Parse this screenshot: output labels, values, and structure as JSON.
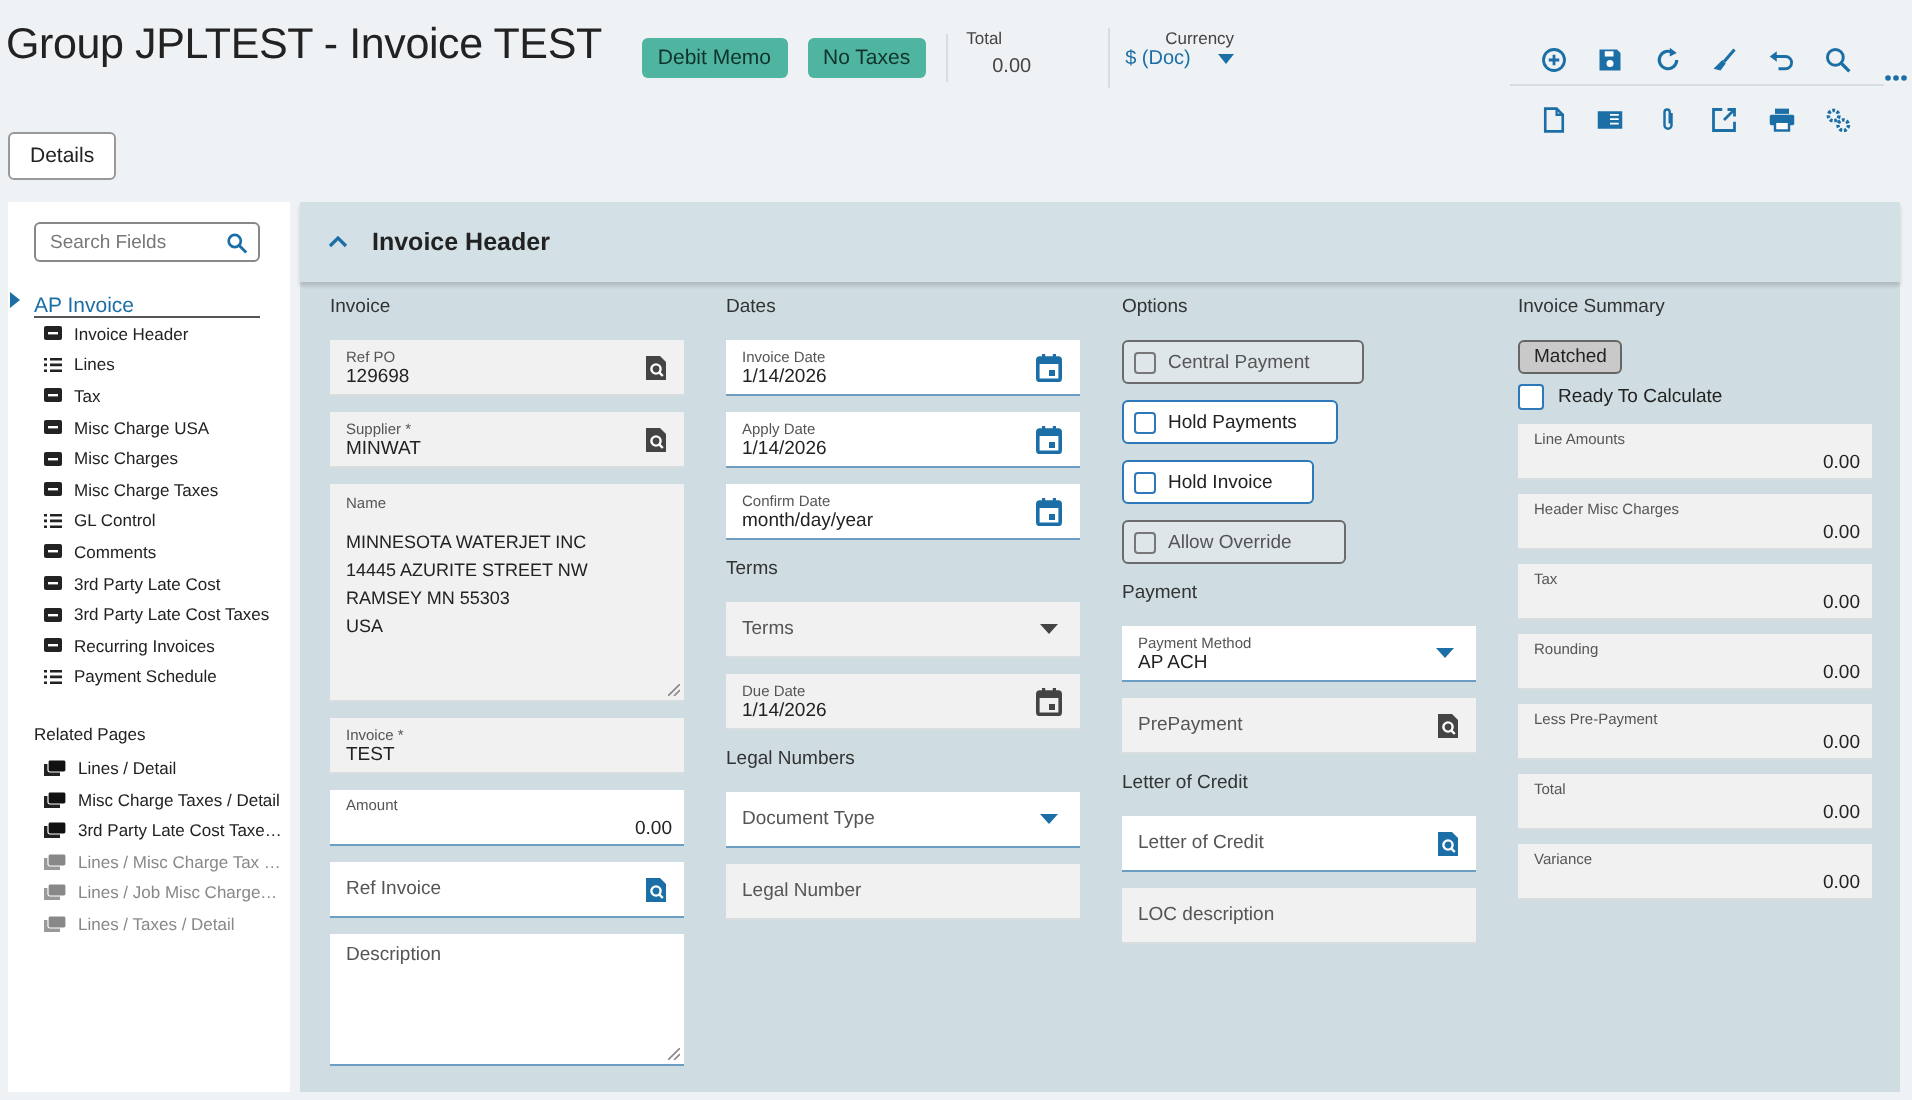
{
  "header": {
    "title": "Group JPLTEST - Invoice TEST",
    "badges": [
      "Debit Memo",
      "No Taxes"
    ],
    "total": {
      "label": "Total",
      "value": "0.00"
    },
    "currency": {
      "label": "Currency",
      "value": "$ (Doc)"
    }
  },
  "details_button": "Details",
  "sidebar": {
    "search": {
      "placeholder": "Search Fields"
    },
    "tree": [
      {
        "label": "AP Invoice",
        "children": [
          {
            "label": "Invoice Header",
            "kind": "form"
          },
          {
            "label": "Lines",
            "kind": "grid"
          },
          {
            "label": "Tax",
            "kind": "form"
          },
          {
            "label": "Misc Charge USA",
            "kind": "form"
          },
          {
            "label": "Misc Charges",
            "kind": "form"
          },
          {
            "label": "Misc Charge Taxes",
            "kind": "form"
          },
          {
            "label": "GL Control",
            "kind": "grid"
          },
          {
            "label": "Comments",
            "kind": "form"
          },
          {
            "label": "3rd Party Late Cost",
            "kind": "form"
          },
          {
            "label": "3rd Party Late Cost Taxes",
            "kind": "form"
          },
          {
            "label": "Recurring Invoices",
            "kind": "form"
          },
          {
            "label": "Payment Schedule",
            "kind": "grid"
          }
        ]
      }
    ],
    "related_heading": "Related Pages",
    "related": [
      {
        "label": "Lines / Detail",
        "disabled": false
      },
      {
        "label": "Misc Charge Taxes / Detail",
        "disabled": false
      },
      {
        "label": "3rd Party Late Cost Taxe…",
        "disabled": false
      },
      {
        "label": "Lines / Misc Charge Tax …",
        "disabled": true
      },
      {
        "label": "Lines / Job Misc Charge…",
        "disabled": true
      },
      {
        "label": "Lines / Taxes / Detail",
        "disabled": true
      }
    ]
  },
  "panel": {
    "title": "Invoice Header",
    "expanded": true,
    "columns": [
      {
        "sections": [
          {
            "heading": "Invoice",
            "items": [
              {
                "kind": "lookup",
                "label": "Ref PO",
                "value": "129698",
                "disabled": true
              },
              {
                "kind": "lookup",
                "label": "Supplier *",
                "value": "MINWAT",
                "disabled": true
              },
              {
                "kind": "textarea",
                "label": "Name",
                "value": "MINNESOTA WATERJET INC\n14445 AZURITE STREET NW\nRAMSEY MN 55303\nUSA",
                "disabled": true
              },
              {
                "kind": "text",
                "label": "Invoice *",
                "value": "TEST",
                "disabled": true
              },
              {
                "kind": "amount",
                "label": "Amount",
                "value": "0.00",
                "disabled": false
              },
              {
                "kind": "lookup",
                "placeholder": "Ref Invoice",
                "disabled": false
              },
              {
                "kind": "textarea",
                "placeholder": "Description",
                "disabled": false
              }
            ]
          }
        ]
      },
      {
        "sections": [
          {
            "heading": "Dates",
            "items": [
              {
                "kind": "date",
                "label": "Invoice Date",
                "value": "1/14/2026",
                "disabled": false
              },
              {
                "kind": "date",
                "label": "Apply Date",
                "value": "1/14/2026",
                "disabled": false
              },
              {
                "kind": "date",
                "label": "Confirm Date",
                "value": "month/day/year",
                "disabled": false
              }
            ]
          },
          {
            "heading": "Terms",
            "items": [
              {
                "kind": "select",
                "placeholder": "Terms",
                "disabled": true
              },
              {
                "kind": "date",
                "label": "Due Date",
                "value": "1/14/2026",
                "disabled": true
              }
            ]
          },
          {
            "heading": "Legal Numbers",
            "items": [
              {
                "kind": "select",
                "placeholder": "Document Type",
                "disabled": false
              },
              {
                "kind": "text",
                "placeholder": "Legal Number",
                "disabled": true
              }
            ]
          }
        ]
      },
      {
        "sections": [
          {
            "heading": "Options",
            "items": [
              {
                "kind": "option",
                "label": "Central Payment",
                "checked": false,
                "disabled": true
              },
              {
                "kind": "option",
                "label": "Hold Payments",
                "checked": false,
                "disabled": false
              },
              {
                "kind": "option",
                "label": "Hold Invoice",
                "checked": false,
                "disabled": false
              },
              {
                "kind": "option",
                "label": "Allow Override",
                "checked": false,
                "disabled": true
              }
            ]
          },
          {
            "heading": "Payment",
            "items": [
              {
                "kind": "select",
                "label": "Payment Method",
                "value": "AP ACH",
                "disabled": false
              },
              {
                "kind": "lookup",
                "placeholder": "PrePayment",
                "disabled": true
              }
            ]
          },
          {
            "heading": "Letter of Credit",
            "items": [
              {
                "kind": "lookup",
                "placeholder": "Letter of Credit",
                "disabled": false
              },
              {
                "kind": "text",
                "placeholder": "LOC description",
                "disabled": true
              }
            ]
          }
        ]
      },
      {
        "sections": [
          {
            "heading": "Invoice Summary",
            "items": [
              {
                "kind": "tag",
                "label": "Matched"
              },
              {
                "kind": "checkbox",
                "label": "Ready To Calculate",
                "checked": false
              },
              {
                "kind": "amount",
                "label": "Line Amounts",
                "value": "0.00",
                "disabled": true
              },
              {
                "kind": "amount",
                "label": "Header Misc Charges",
                "value": "0.00",
                "disabled": true
              },
              {
                "kind": "amount",
                "label": "Tax",
                "value": "0.00",
                "disabled": true
              },
              {
                "kind": "amount",
                "label": "Rounding",
                "value": "0.00",
                "disabled": true
              },
              {
                "kind": "amount",
                "label": "Less Pre-Payment",
                "value": "0.00",
                "disabled": true
              },
              {
                "kind": "amount",
                "label": "Total",
                "value": "0.00",
                "disabled": true
              },
              {
                "kind": "amount",
                "label": "Variance",
                "value": "0.00",
                "disabled": true
              }
            ]
          }
        ]
      }
    ]
  }
}
